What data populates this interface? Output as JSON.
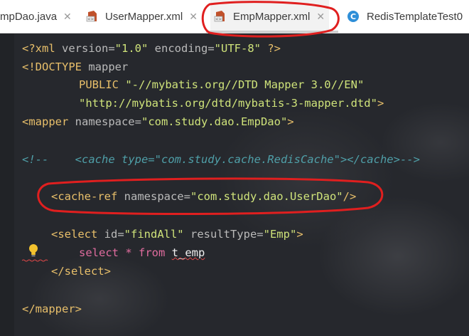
{
  "tabs": [
    {
      "label": "mpDao.java",
      "icon": "java-file-icon",
      "active": false
    },
    {
      "label": "UserMapper.xml",
      "icon": "xml-file-icon",
      "active": false
    },
    {
      "label": "EmpMapper.xml",
      "icon": "xml-file-icon",
      "active": true
    },
    {
      "label": "RedisTemplateTest0",
      "icon": "class-file-icon",
      "active": false
    }
  ],
  "code": {
    "l1_a": "<?xml ",
    "l1_b": "version=",
    "l1_c": "\"1.0\"",
    "l1_d": " encoding=",
    "l1_e": "\"UTF-8\"",
    "l1_f": " ?>",
    "l2_a": "<!DOCTYPE ",
    "l2_b": "mapper",
    "l3_a": "PUBLIC ",
    "l3_b": "\"-//mybatis.org//DTD Mapper 3.0//EN\"",
    "l4_a": "\"http://mybatis.org/dtd/mybatis-3-mapper.dtd\"",
    "l4_b": ">",
    "l5_a": "<mapper ",
    "l5_b": "namespace=",
    "l5_c": "\"com.study.dao.EmpDao\"",
    "l5_d": ">",
    "l6_a": "<!--",
    "l6_b": "    <cache ",
    "l6_c": "type=",
    "l6_d": "\"com.study.cache.RedisCache\"",
    "l6_e": "></cache>",
    "l6_f": "-->",
    "l7_a": "<cache-ref ",
    "l7_b": "namespace=",
    "l7_c": "\"com.study.dao.UserDao\"",
    "l7_d": "/>",
    "l8_a": "<select ",
    "l8_b": "id=",
    "l8_c": "\"findAll\"",
    "l8_d": " resultType=",
    "l8_e": "\"Emp\"",
    "l8_f": ">",
    "l9_a": "select ",
    "l9_b": "* ",
    "l9_c": "from ",
    "l9_d": "t_emp",
    "l10_a": "</select>",
    "l11_a": "</mapper>"
  },
  "colors": {
    "tag": "#e8bf6a",
    "attribute": "#bababa",
    "string": "#cfe37a",
    "comment": "#4f9fa8",
    "sql_keyword": "#e06c9e",
    "annotation_circle": "#e01f1f"
  }
}
